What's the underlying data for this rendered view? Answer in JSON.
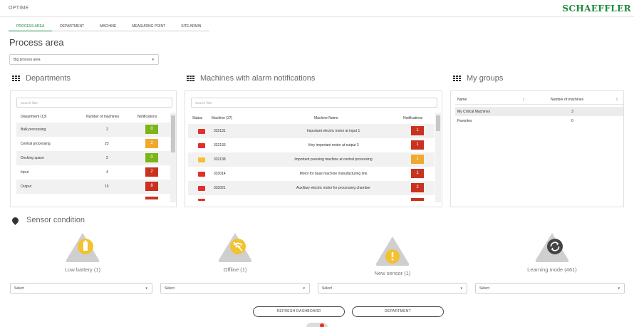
{
  "header": {
    "app_title": "OPTIME",
    "brand": "SCHAEFFLER"
  },
  "tabs": [
    {
      "label": "PROCESS AREA",
      "active": true
    },
    {
      "label": "DEPARTMENT"
    },
    {
      "label": "MACHINE"
    },
    {
      "label": "MEASURING POINT"
    },
    {
      "label": "SITE ADMIN"
    }
  ],
  "page_title": "Process area",
  "process_area_select": {
    "value": "Big process area"
  },
  "departments": {
    "title": "Departments",
    "search_placeholder": "Search filter",
    "columns": [
      "Department (13)",
      "Number of machines",
      "Notifications"
    ],
    "rows": [
      {
        "name": "Bulk processing",
        "machines": "2",
        "notifications": "0",
        "color": "#7cb518"
      },
      {
        "name": "Central processing",
        "machines": "23",
        "notifications": "2",
        "color": "#f0a92d"
      },
      {
        "name": "Docking space",
        "machines": "2",
        "notifications": "0",
        "color": "#7cb518"
      },
      {
        "name": "Input",
        "machines": "4",
        "notifications": "2",
        "color": "#c8321f"
      },
      {
        "name": "Output",
        "machines": "15",
        "notifications": "8",
        "color": "#c8321f"
      }
    ]
  },
  "machines": {
    "title": "Machines with alarm notifications",
    "search_placeholder": "Search filter",
    "columns": [
      "Status",
      "Machine (37)",
      "Machine Name",
      "Notifications"
    ],
    "rows": [
      {
        "id": "332131",
        "name": "Important electric motor at input 1",
        "notifications": "1",
        "color": "#c8321f",
        "status_color": "#e0302a"
      },
      {
        "id": "332133",
        "name": "Very important motor at output 3",
        "notifications": "1",
        "color": "#c8321f",
        "status_color": "#e0302a"
      },
      {
        "id": "332138",
        "name": "Important pressing machine at central processing",
        "notifications": "1",
        "color": "#f0a92d",
        "status_color": "#f2c230"
      },
      {
        "id": "333014",
        "name": "Motor for base machine manufacturing line",
        "notifications": "1",
        "color": "#c8321f",
        "status_color": "#e0302a"
      },
      {
        "id": "333021",
        "name": "Auxiliary electric motor for processing chamber",
        "notifications": "2",
        "color": "#c8321f",
        "status_color": "#e0302a"
      }
    ]
  },
  "groups": {
    "title": "My groups",
    "columns": [
      "Name",
      "Number of machines"
    ],
    "rows": [
      {
        "name": "My Critical Machines",
        "machines": "3"
      },
      {
        "name": "Favorites",
        "machines": "0"
      }
    ]
  },
  "sensor_condition": {
    "title": "Sensor condition",
    "items": [
      {
        "label": "Low battery (1)",
        "icon": "battery-icon",
        "color": "#f2c230"
      },
      {
        "label": "Offline (1)",
        "icon": "wifi-off-icon",
        "color": "#f2c230"
      },
      {
        "label": "New sensor (1)",
        "icon": "exclamation-icon",
        "color": "#f2c230"
      },
      {
        "label": "Learning mode (461)",
        "icon": "refresh-icon",
        "color": "#444444"
      }
    ],
    "selects": [
      "Select",
      "Select",
      "Select",
      "Select"
    ]
  },
  "actions": {
    "refresh": "REFRESH DASHBOARD",
    "department": "DEPARTMENT"
  },
  "colors": {
    "brand": "#1d8a3b",
    "red": "#c8321f",
    "orange": "#f0a92d",
    "green": "#7cb518"
  }
}
